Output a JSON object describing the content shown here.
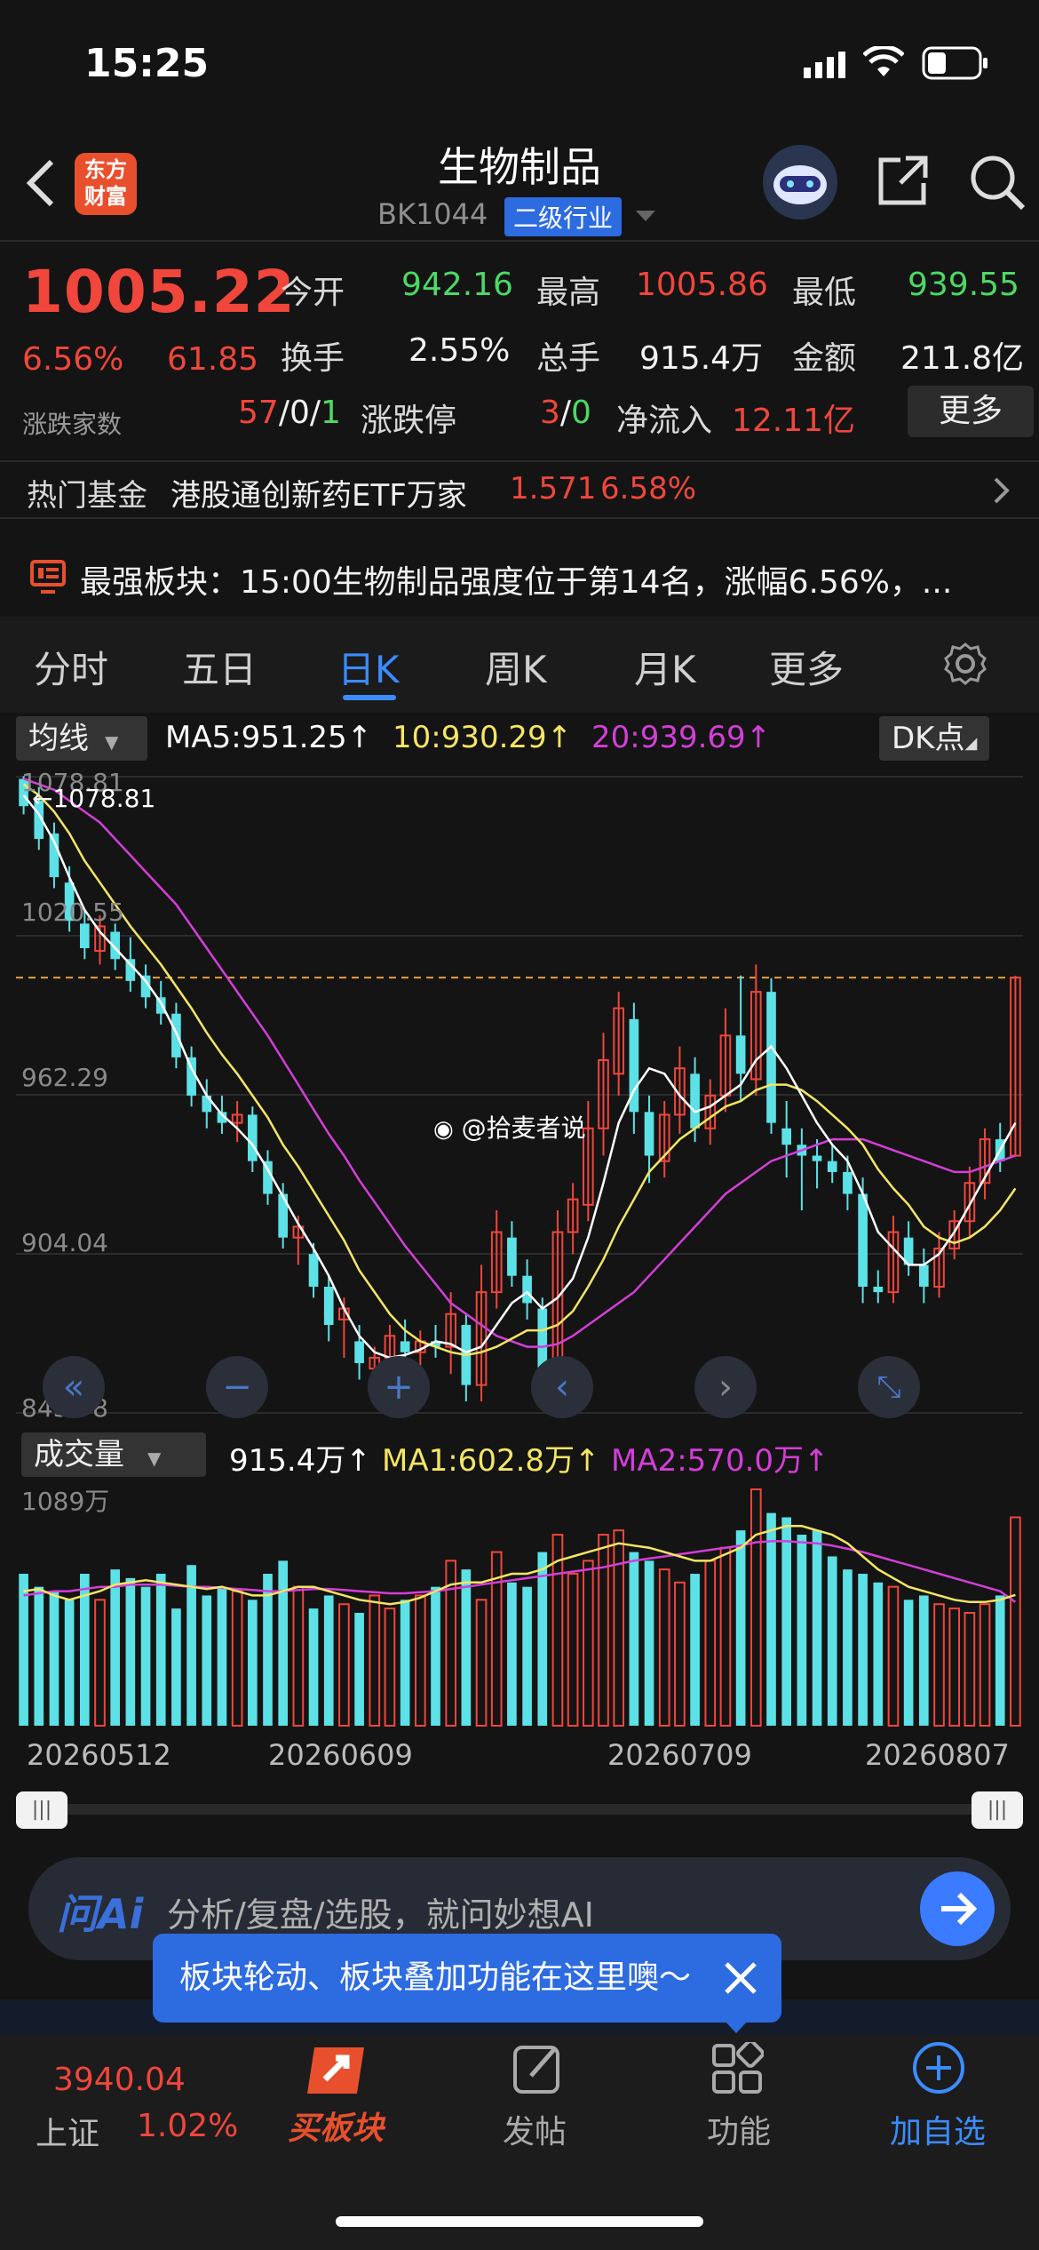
{
  "status_bar": {
    "time": "15:25"
  },
  "header": {
    "logo_text": "东方财富",
    "title": "生物制品",
    "code": "BK1044",
    "category_badge": "二级行业"
  },
  "quote": {
    "price": "1005.22",
    "change_pct": "6.56%",
    "change_abs": "61.85",
    "adv_dec_label": "涨跌家数",
    "adv": "57",
    "flat": "0",
    "dec": "1",
    "fields": {
      "open_label": "今开",
      "open": "942.16",
      "high_label": "最高",
      "high": "1005.86",
      "low_label": "最低",
      "low": "939.55",
      "turnover_label": "换手",
      "turnover": "2.55%",
      "volume_label": "总手",
      "volume": "915.4万",
      "amount_label": "金额",
      "amount": "211.8亿",
      "limit_label": "涨跌停",
      "limit_up": "3",
      "limit_down": "0",
      "inflow_label": "净流入",
      "inflow": "12.11亿"
    },
    "more_button": "更多"
  },
  "hot_fund": {
    "label": "热门基金",
    "name": "港股通创新药ETF万家",
    "price": "1.571",
    "change": "6.58%"
  },
  "strongest_sector": {
    "label": "最强板块：",
    "text": "15:00生物制品强度位于第14名，涨幅6.56%，..."
  },
  "tabs": [
    "分时",
    "五日",
    "日K",
    "周K",
    "月K",
    "更多"
  ],
  "active_tab": "日K",
  "ma_bar": {
    "selector": "均线",
    "ma5": "MA5:951.25",
    "ma10": "10:930.29",
    "ma20": "20:939.69",
    "dk_button": "DK点"
  },
  "price_axis": [
    "1078.81",
    "1020.55",
    "962.29",
    "904.04",
    "845.78"
  ],
  "max_marker": "1078.81",
  "watermark": "@拾麦者说",
  "volume_bar": {
    "selector": "成交量",
    "vol": "915.4万",
    "ma1": "MA1:602.8万",
    "ma2": "MA2:570.0万",
    "max_label": "1089万"
  },
  "date_axis": [
    "20260512",
    "20260609",
    "20260709",
    "20260807"
  ],
  "ai_bar": {
    "logo": "问Ai",
    "placeholder": "分析/复盘/选股，就问妙想AI"
  },
  "tooltip": {
    "text": "板块轮动、板块叠加功能在这里噢～"
  },
  "bottom_nav": {
    "index_value": "3940.04",
    "index_name": "上证",
    "index_change": "1.02%",
    "items": [
      "买板块",
      "发帖",
      "功能",
      "加自选"
    ]
  },
  "colors": {
    "up": "#f0463c",
    "down": "#5ce1e6",
    "ma5": "#ffffff",
    "ma10": "#f5e663",
    "ma20": "#d43ed8",
    "accent": "#3b8cff"
  },
  "chart_data": {
    "type": "candlestick",
    "ylim": [
      845.78,
      1078.81
    ],
    "candles": [
      {
        "o": 1078,
        "h": 1079,
        "l": 1065,
        "c": 1068
      },
      {
        "o": 1070,
        "h": 1075,
        "l": 1052,
        "c": 1056
      },
      {
        "o": 1058,
        "h": 1062,
        "l": 1038,
        "c": 1042
      },
      {
        "o": 1040,
        "h": 1046,
        "l": 1022,
        "c": 1026
      },
      {
        "o": 1025,
        "h": 1030,
        "l": 1012,
        "c": 1016
      },
      {
        "o": 1015,
        "h": 1028,
        "l": 1010,
        "c": 1024
      },
      {
        "o": 1022,
        "h": 1025,
        "l": 1008,
        "c": 1012
      },
      {
        "o": 1012,
        "h": 1020,
        "l": 1000,
        "c": 1004
      },
      {
        "o": 1006,
        "h": 1010,
        "l": 994,
        "c": 998
      },
      {
        "o": 998,
        "h": 1004,
        "l": 988,
        "c": 992
      },
      {
        "o": 992,
        "h": 996,
        "l": 972,
        "c": 976
      },
      {
        "o": 976,
        "h": 980,
        "l": 958,
        "c": 962
      },
      {
        "o": 962,
        "h": 968,
        "l": 950,
        "c": 956
      },
      {
        "o": 956,
        "h": 962,
        "l": 948,
        "c": 952
      },
      {
        "o": 952,
        "h": 960,
        "l": 945,
        "c": 955
      },
      {
        "o": 955,
        "h": 958,
        "l": 934,
        "c": 938
      },
      {
        "o": 938,
        "h": 942,
        "l": 922,
        "c": 926
      },
      {
        "o": 926,
        "h": 930,
        "l": 906,
        "c": 910
      },
      {
        "o": 910,
        "h": 918,
        "l": 900,
        "c": 914
      },
      {
        "o": 904,
        "h": 908,
        "l": 888,
        "c": 892
      },
      {
        "o": 892,
        "h": 896,
        "l": 872,
        "c": 878
      },
      {
        "o": 880,
        "h": 888,
        "l": 866,
        "c": 884
      },
      {
        "o": 872,
        "h": 878,
        "l": 858,
        "c": 864
      },
      {
        "o": 862,
        "h": 870,
        "l": 852,
        "c": 866
      },
      {
        "o": 866,
        "h": 878,
        "l": 860,
        "c": 874
      },
      {
        "o": 872,
        "h": 880,
        "l": 864,
        "c": 868
      },
      {
        "o": 868,
        "h": 876,
        "l": 862,
        "c": 872
      },
      {
        "o": 872,
        "h": 878,
        "l": 866,
        "c": 870
      },
      {
        "o": 870,
        "h": 890,
        "l": 860,
        "c": 882
      },
      {
        "o": 878,
        "h": 882,
        "l": 850,
        "c": 856
      },
      {
        "o": 856,
        "h": 900,
        "l": 850,
        "c": 890
      },
      {
        "o": 890,
        "h": 920,
        "l": 884,
        "c": 912
      },
      {
        "o": 910,
        "h": 916,
        "l": 892,
        "c": 896
      },
      {
        "o": 896,
        "h": 902,
        "l": 880,
        "c": 886
      },
      {
        "o": 884,
        "h": 888,
        "l": 848,
        "c": 856
      },
      {
        "o": 858,
        "h": 920,
        "l": 846,
        "c": 912
      },
      {
        "o": 912,
        "h": 930,
        "l": 904,
        "c": 924
      },
      {
        "o": 922,
        "h": 960,
        "l": 916,
        "c": 950
      },
      {
        "o": 950,
        "h": 985,
        "l": 940,
        "c": 975
      },
      {
        "o": 970,
        "h": 1000,
        "l": 962,
        "c": 994
      },
      {
        "o": 990,
        "h": 996,
        "l": 948,
        "c": 956
      },
      {
        "o": 956,
        "h": 962,
        "l": 930,
        "c": 940
      },
      {
        "o": 938,
        "h": 960,
        "l": 932,
        "c": 955
      },
      {
        "o": 955,
        "h": 980,
        "l": 948,
        "c": 972
      },
      {
        "o": 970,
        "h": 976,
        "l": 945,
        "c": 950
      },
      {
        "o": 950,
        "h": 968,
        "l": 944,
        "c": 962
      },
      {
        "o": 962,
        "h": 994,
        "l": 956,
        "c": 984
      },
      {
        "o": 984,
        "h": 1006,
        "l": 960,
        "c": 970
      },
      {
        "o": 968,
        "h": 1010,
        "l": 962,
        "c": 1000
      },
      {
        "o": 1000,
        "h": 1005,
        "l": 948,
        "c": 952
      },
      {
        "o": 950,
        "h": 960,
        "l": 932,
        "c": 944
      },
      {
        "o": 944,
        "h": 950,
        "l": 920,
        "c": 940
      },
      {
        "o": 940,
        "h": 946,
        "l": 928,
        "c": 938
      },
      {
        "o": 938,
        "h": 944,
        "l": 930,
        "c": 934
      },
      {
        "o": 934,
        "h": 940,
        "l": 920,
        "c": 926
      },
      {
        "o": 926,
        "h": 932,
        "l": 886,
        "c": 892
      },
      {
        "o": 892,
        "h": 898,
        "l": 886,
        "c": 890
      },
      {
        "o": 890,
        "h": 918,
        "l": 886,
        "c": 912
      },
      {
        "o": 910,
        "h": 916,
        "l": 896,
        "c": 900
      },
      {
        "o": 900,
        "h": 906,
        "l": 886,
        "c": 892
      },
      {
        "o": 892,
        "h": 912,
        "l": 888,
        "c": 906
      },
      {
        "o": 906,
        "h": 920,
        "l": 902,
        "c": 916
      },
      {
        "o": 916,
        "h": 936,
        "l": 910,
        "c": 930
      },
      {
        "o": 930,
        "h": 950,
        "l": 924,
        "c": 946
      },
      {
        "o": 946,
        "h": 952,
        "l": 934,
        "c": 938
      },
      {
        "o": 940,
        "h": 1005.86,
        "l": 939.55,
        "c": 1005.22
      }
    ],
    "ma5": [
      1072,
      1065,
      1055,
      1042,
      1030,
      1022,
      1016,
      1010,
      1004,
      996,
      985,
      972,
      962,
      955,
      950,
      944,
      935,
      925,
      915,
      906,
      896,
      884,
      874,
      868,
      866,
      867,
      869,
      872,
      871,
      868,
      870,
      878,
      886,
      890,
      884,
      888,
      895,
      910,
      930,
      952,
      964,
      972,
      970,
      962,
      956,
      958,
      962,
      966,
      975,
      980,
      972,
      962,
      952,
      944,
      938,
      926,
      912,
      906,
      900,
      900,
      904,
      912,
      922,
      932,
      942,
      952
    ],
    "ma10": [
      1076,
      1072,
      1066,
      1058,
      1048,
      1040,
      1032,
      1024,
      1017,
      1010,
      1002,
      994,
      985,
      977,
      970,
      962,
      954,
      944,
      936,
      927,
      918,
      909,
      898,
      890,
      882,
      876,
      872,
      870,
      868,
      867,
      868,
      870,
      873,
      876,
      876,
      878,
      883,
      892,
      902,
      914,
      924,
      934,
      940,
      946,
      950,
      954,
      958,
      960,
      964,
      966,
      966,
      964,
      960,
      955,
      950,
      944,
      935,
      928,
      922,
      914,
      910,
      908,
      910,
      914,
      920,
      928
    ],
    "ma20": [
      1078,
      1076,
      1074,
      1070,
      1066,
      1062,
      1056,
      1050,
      1044,
      1038,
      1032,
      1024,
      1016,
      1008,
      1000,
      992,
      984,
      975,
      966,
      957,
      948,
      940,
      931,
      923,
      915,
      907,
      900,
      893,
      886,
      882,
      878,
      874,
      872,
      870,
      870,
      871,
      874,
      878,
      882,
      886,
      890,
      896,
      902,
      908,
      914,
      920,
      926,
      930,
      934,
      938,
      940,
      942,
      944,
      946,
      946,
      946,
      944,
      942,
      940,
      938,
      936,
      934,
      934,
      936,
      938,
      940
    ],
    "volume": [
      700,
      640,
      620,
      580,
      700,
      580,
      720,
      680,
      640,
      700,
      540,
      740,
      600,
      640,
      620,
      580,
      700,
      760,
      640,
      540,
      600,
      560,
      520,
      600,
      540,
      580,
      600,
      640,
      760,
      720,
      580,
      800,
      660,
      640,
      800,
      880,
      700,
      760,
      880,
      900,
      800,
      760,
      720,
      660,
      700,
      760,
      820,
      900,
      1089,
      980,
      960,
      880,
      900,
      780,
      720,
      700,
      660,
      640,
      580,
      600,
      560,
      540,
      520,
      560,
      600,
      960
    ],
    "vol_ma1": [
      620,
      630,
      600,
      580,
      600,
      620,
      650,
      660,
      670,
      660,
      650,
      640,
      630,
      640,
      620,
      600,
      600,
      620,
      640,
      640,
      620,
      600,
      580,
      570,
      560,
      570,
      590,
      620,
      650,
      660,
      660,
      680,
      700,
      700,
      720,
      760,
      780,
      800,
      820,
      840,
      830,
      820,
      800,
      780,
      760,
      760,
      790,
      820,
      880,
      900,
      920,
      920,
      900,
      880,
      840,
      780,
      720,
      680,
      640,
      620,
      600,
      580,
      570,
      570,
      580,
      602.8
    ],
    "vol_ma2": [
      600,
      610,
      620,
      620,
      630,
      640,
      640,
      650,
      650,
      650,
      645,
      640,
      640,
      635,
      630,
      625,
      620,
      620,
      625,
      630,
      630,
      625,
      620,
      615,
      610,
      610,
      615,
      620,
      630,
      640,
      650,
      660,
      670,
      680,
      690,
      700,
      710,
      720,
      730,
      745,
      760,
      770,
      780,
      790,
      800,
      810,
      820,
      830,
      845,
      850,
      850,
      845,
      840,
      830,
      815,
      800,
      780,
      760,
      740,
      720,
      700,
      680,
      660,
      640,
      620,
      570
    ]
  }
}
